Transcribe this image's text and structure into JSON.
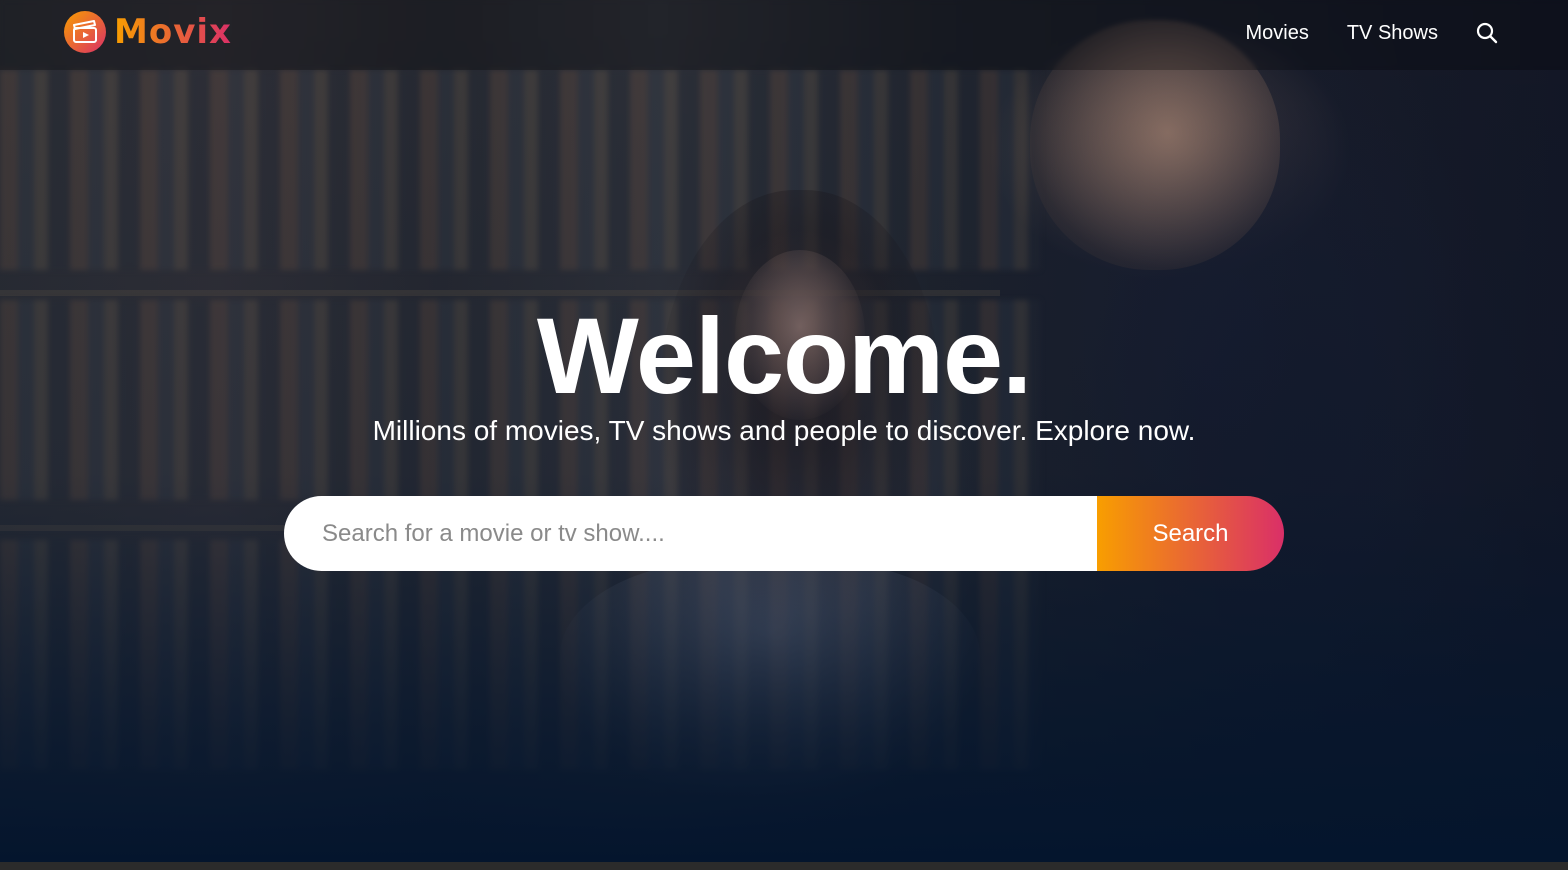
{
  "brand": {
    "name": "Movix",
    "logo_icon": "clapperboard-play-icon",
    "gradient_start": "#f89e00",
    "gradient_end": "#da2f68"
  },
  "nav": {
    "items": [
      {
        "label": "Movies"
      },
      {
        "label": "TV Shows"
      }
    ],
    "search_icon": "search-icon"
  },
  "hero": {
    "title": "Welcome.",
    "subtitle": "Millions of movies, TV shows and people to discover. Explore now.",
    "background_color": "#04152d"
  },
  "search": {
    "placeholder": "Search for a movie or tv show....",
    "value": "",
    "button_label": "Search"
  }
}
